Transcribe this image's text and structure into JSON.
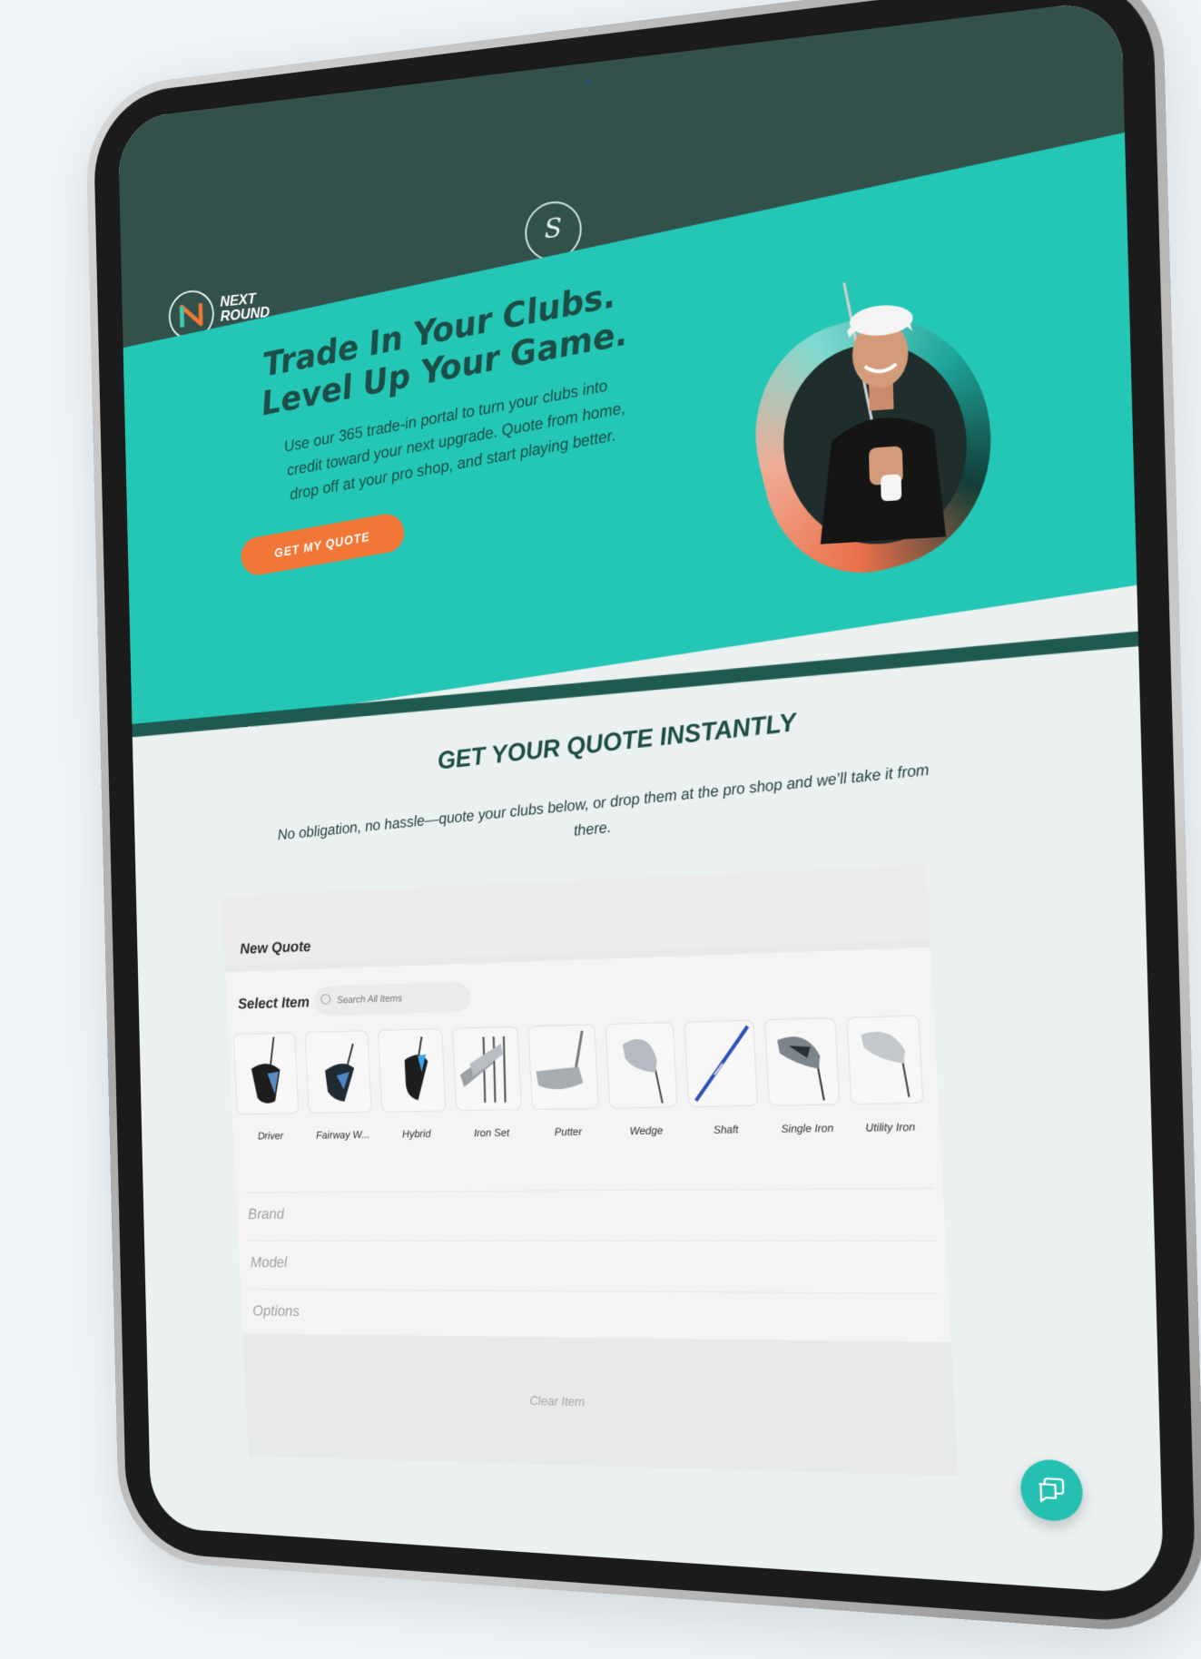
{
  "header": {
    "logo_line1": "NEXT",
    "logo_line2": "ROUND",
    "crest_glyph": "S"
  },
  "hero": {
    "title_line1": "Trade In Your Clubs.",
    "title_line2": "Level Up Your Game.",
    "description": "Use our 365 trade-in portal to turn your clubs into credit toward your next upgrade. Quote from home, drop off at your pro shop, and start playing better.",
    "cta_label": "GET MY QUOTE"
  },
  "quote": {
    "title": "GET YOUR QUOTE INSTANTLY",
    "subtitle": "No obligation, no hassle—quote your clubs below, or drop them at the pro shop and we’ll take it from there."
  },
  "panel": {
    "title": "New Quote",
    "select_label": "Select Item",
    "search_placeholder": "Search All Items",
    "items": [
      {
        "label": "Driver",
        "icon": "driver-icon"
      },
      {
        "label": "Fairway W...",
        "icon": "fairway-wood-icon"
      },
      {
        "label": "Hybrid",
        "icon": "hybrid-icon"
      },
      {
        "label": "Iron Set",
        "icon": "iron-set-icon"
      },
      {
        "label": "Putter",
        "icon": "putter-icon"
      },
      {
        "label": "Wedge",
        "icon": "wedge-icon"
      },
      {
        "label": "Shaft",
        "icon": "shaft-icon"
      },
      {
        "label": "Single Iron",
        "icon": "single-iron-icon"
      },
      {
        "label": "Utility Iron",
        "icon": "utility-iron-icon"
      }
    ],
    "fields": {
      "brand": "Brand",
      "model": "Model",
      "options": "Options"
    },
    "clear_label": "Clear Item"
  },
  "colors": {
    "header": "#33514b",
    "hero": "#24c7b5",
    "accent": "#f27635",
    "text_dark": "#1c4d46"
  }
}
